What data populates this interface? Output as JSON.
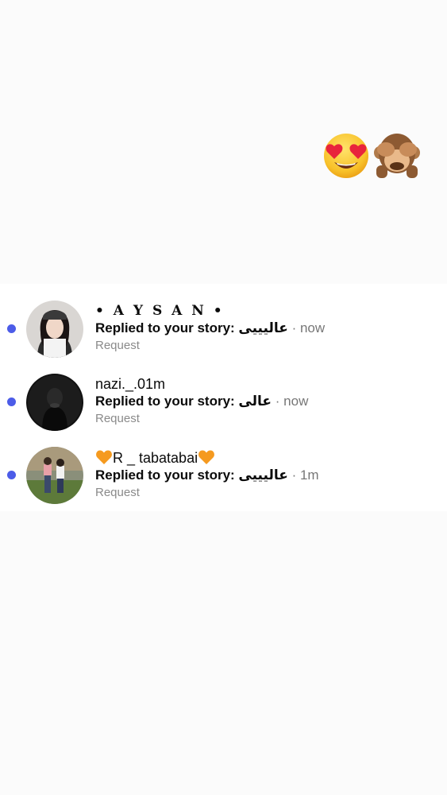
{
  "reaction": {
    "emojis": [
      "heart-eyes-emoji",
      "see-no-evil-monkey-emoji"
    ]
  },
  "colors": {
    "unread_dot": "#4c5ce8",
    "secondary_text": "#777777",
    "request_text": "#8a8a8a"
  },
  "requests": [
    {
      "username": "• A Y S A N •",
      "message_prefix": "Replied to your story:",
      "message_text": "عالیییی",
      "separator": "·",
      "time": "now",
      "status": "Request",
      "unread": true
    },
    {
      "username": "nazi._.01m",
      "message_prefix": "Replied to your story:",
      "message_text": "عالی",
      "separator": "·",
      "time": "now",
      "status": "Request",
      "unread": true
    },
    {
      "username": "R _ tabatabai",
      "username_decoration": "orange-heart-emoji",
      "message_prefix": "Replied to your story:",
      "message_text": "عاليييى",
      "separator": "·",
      "time": "1m",
      "status": "Request",
      "unread": true
    }
  ]
}
